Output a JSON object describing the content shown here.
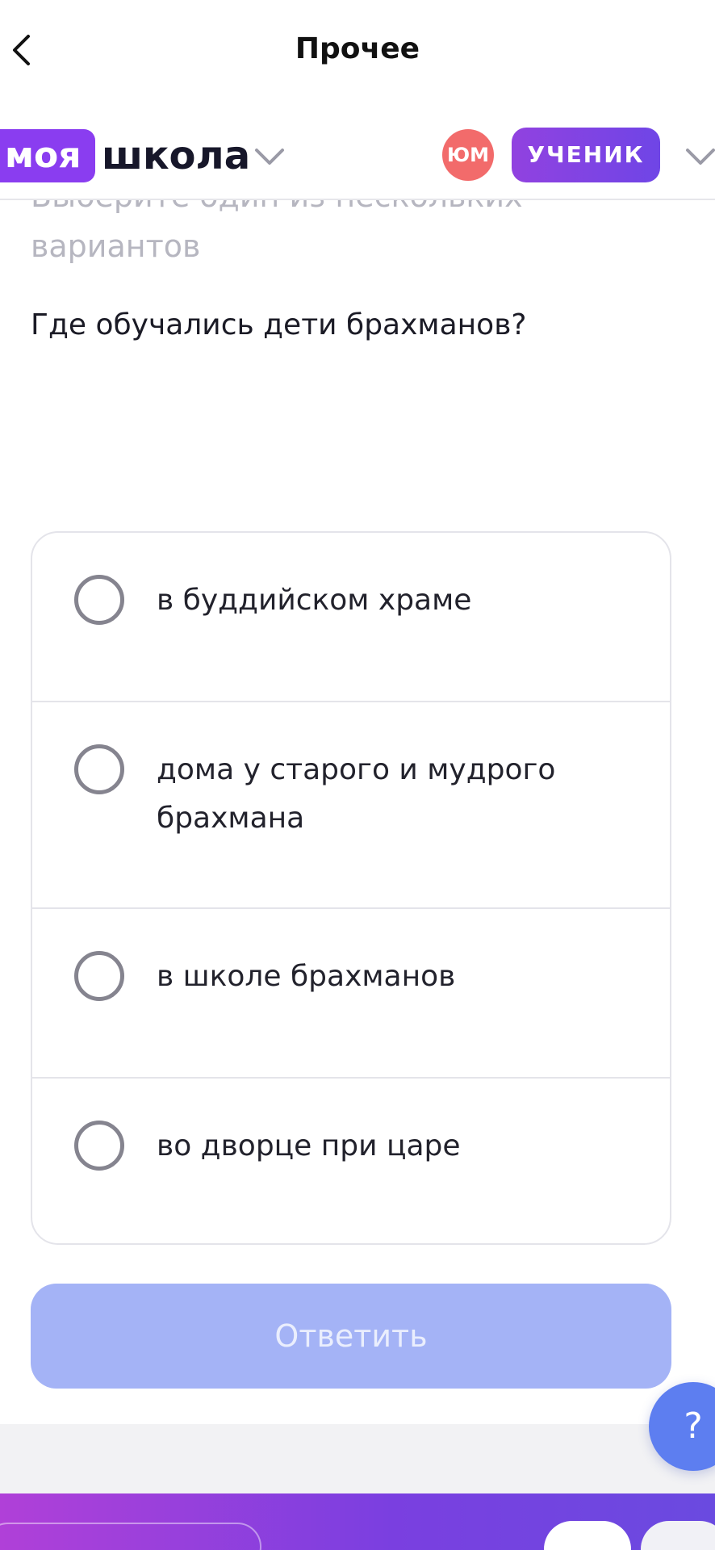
{
  "nav": {
    "title": "Прочее",
    "back_icon": "chevron-left-icon"
  },
  "header": {
    "logo_part1": "моя",
    "logo_part2": "школа",
    "avatar_initials": "ЮМ",
    "role": "УЧЕНИК",
    "brand_color": "#8a3df0",
    "avatar_color": "#f26b6b"
  },
  "quiz": {
    "instruction": "Выберите один из нескольких вариантов",
    "question": "Где обучались дети брахманов?",
    "options": [
      {
        "label": "в буддийском храме"
      },
      {
        "label": "дома у старого и мудрого брахмана"
      },
      {
        "label": "в школе брахманов"
      },
      {
        "label": "во дворце при царе"
      }
    ],
    "submit_label": "Ответить",
    "submit_color": "#a4b3f6"
  },
  "help": {
    "label": "?"
  }
}
